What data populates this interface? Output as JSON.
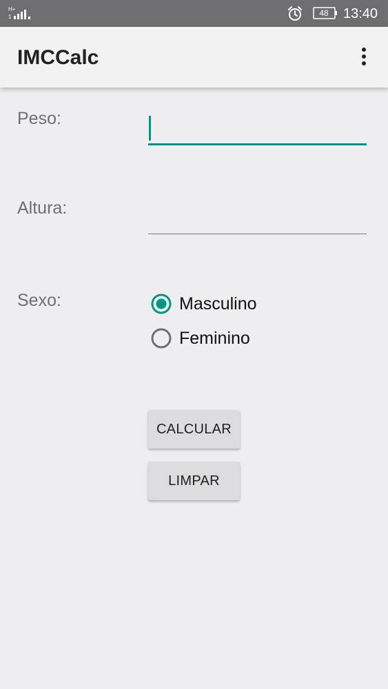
{
  "status_bar": {
    "signal_icon": "signal-icon",
    "alarm_icon": "alarm-icon",
    "battery_level": "48",
    "time": "13:40"
  },
  "app_bar": {
    "title": "IMCCalc",
    "menu_icon": "overflow-menu-icon"
  },
  "form": {
    "peso_label": "Peso:",
    "peso_value": "",
    "altura_label": "Altura:",
    "altura_value": "",
    "sexo_label": "Sexo:",
    "sexo_options": [
      {
        "label": "Masculino",
        "selected": true
      },
      {
        "label": "Feminino",
        "selected": false
      }
    ]
  },
  "buttons": {
    "calcular": "CALCULAR",
    "limpar": "LIMPAR"
  },
  "colors": {
    "accent": "#009685",
    "status_bar": "#6e6e70",
    "background": "#eeedf0"
  }
}
